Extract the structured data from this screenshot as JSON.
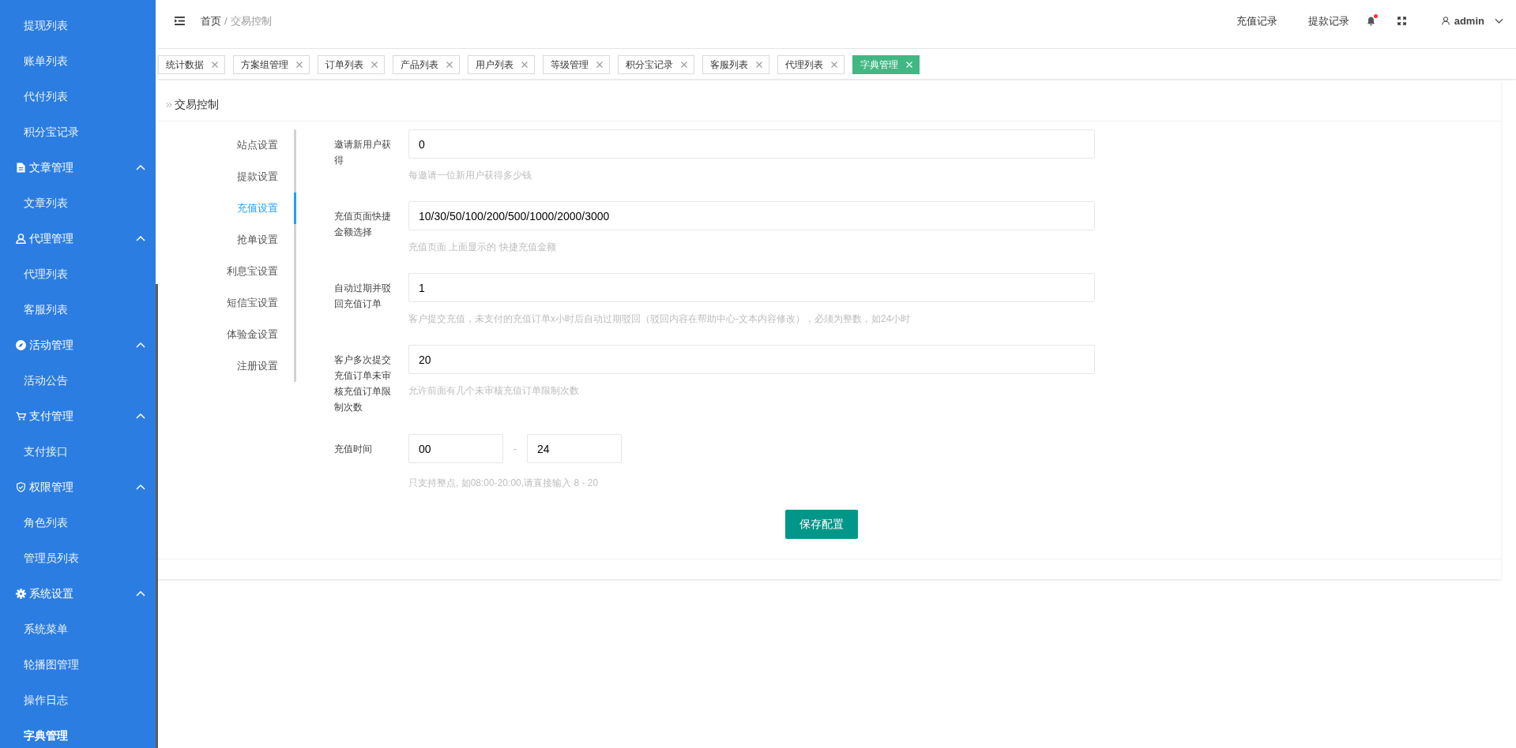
{
  "header": {
    "breadcrumb": [
      {
        "label": "首页"
      },
      {
        "label": "交易控制"
      }
    ],
    "breadcrumb_separator": "/",
    "links": [
      {
        "label": "充值记录"
      },
      {
        "label": "提款记录"
      }
    ],
    "notification_unread": true,
    "user": {
      "name": "admin"
    }
  },
  "sidebar": {
    "continued_items": [
      {
        "label": "提现列表",
        "selected": false
      },
      {
        "label": "账单列表",
        "selected": false
      },
      {
        "label": "代付列表",
        "selected": false
      },
      {
        "label": "积分宝记录",
        "selected": false
      }
    ],
    "groups": [
      {
        "label": "文章管理",
        "expanded": true,
        "children": [
          {
            "label": "文章列表",
            "selected": false
          }
        ]
      },
      {
        "label": "代理管理",
        "expanded": true,
        "children": [
          {
            "label": "代理列表",
            "selected": false
          },
          {
            "label": "客服列表",
            "selected": false
          }
        ]
      },
      {
        "label": "活动管理",
        "expanded": true,
        "children": [
          {
            "label": "活动公告",
            "selected": false
          }
        ]
      },
      {
        "label": "支付管理",
        "expanded": true,
        "children": [
          {
            "label": "支付接口",
            "selected": false
          }
        ]
      },
      {
        "label": "权限管理",
        "expanded": true,
        "children": [
          {
            "label": "角色列表",
            "selected": false
          },
          {
            "label": "管理员列表",
            "selected": false
          }
        ]
      },
      {
        "label": "系统设置",
        "expanded": true,
        "children": [
          {
            "label": "系统菜单",
            "selected": false
          },
          {
            "label": "轮播图管理",
            "selected": false
          },
          {
            "label": "操作日志",
            "selected": false
          },
          {
            "label": "字典管理",
            "selected": true
          }
        ]
      }
    ]
  },
  "tabs": [
    {
      "label": "统计数据",
      "selected": false
    },
    {
      "label": "方案组管理",
      "selected": false
    },
    {
      "label": "订单列表",
      "selected": false
    },
    {
      "label": "产品列表",
      "selected": false
    },
    {
      "label": "用户列表",
      "selected": false
    },
    {
      "label": "等级管理",
      "selected": false
    },
    {
      "label": "积分宝记录",
      "selected": false
    },
    {
      "label": "客服列表",
      "selected": false
    },
    {
      "label": "代理列表",
      "selected": false
    },
    {
      "label": "字典管理",
      "selected": true
    }
  ],
  "card": {
    "title": "交易控制"
  },
  "settings_tabs": [
    {
      "label": "站点设置",
      "selected": false
    },
    {
      "label": "提款设置",
      "selected": false
    },
    {
      "label": "充值设置",
      "selected": true
    },
    {
      "label": "抢单设置",
      "selected": false
    },
    {
      "label": "利息宝设置",
      "selected": false
    },
    {
      "label": "短信宝设置",
      "selected": false
    },
    {
      "label": "体验金设置",
      "selected": false
    },
    {
      "label": "注册设置",
      "selected": false
    }
  ],
  "form": {
    "fields": [
      {
        "kind": "text",
        "label": "邀请新用户获得",
        "value": "0",
        "help": "每邀请一位新用户获得多少钱"
      },
      {
        "kind": "text",
        "label": "充值页面快捷金额选择",
        "value": "10/30/50/100/200/500/1000/2000/3000",
        "help": "充值页面 上面显示的 快捷充值金额"
      },
      {
        "kind": "text",
        "label": "自动过期并驳回充值订单",
        "value": "1",
        "help": "客户提交充值，未支付的充值订单x小时后自动过期驳回（驳回内容在帮助中心-文本内容修改），必须为整数，如24小时"
      },
      {
        "kind": "text",
        "label": "客户多次提交充值订单未审核充值订单限制次数",
        "value": "20",
        "help": "允许前面有几个未审核充值订单限制次数"
      },
      {
        "kind": "range",
        "label": "充值时间",
        "values": [
          "00",
          "24"
        ],
        "separator": "-",
        "help": "只支持整点, 如08:00-20:00,请直接输入 8 - 20"
      }
    ],
    "submit": "保存配置"
  }
}
